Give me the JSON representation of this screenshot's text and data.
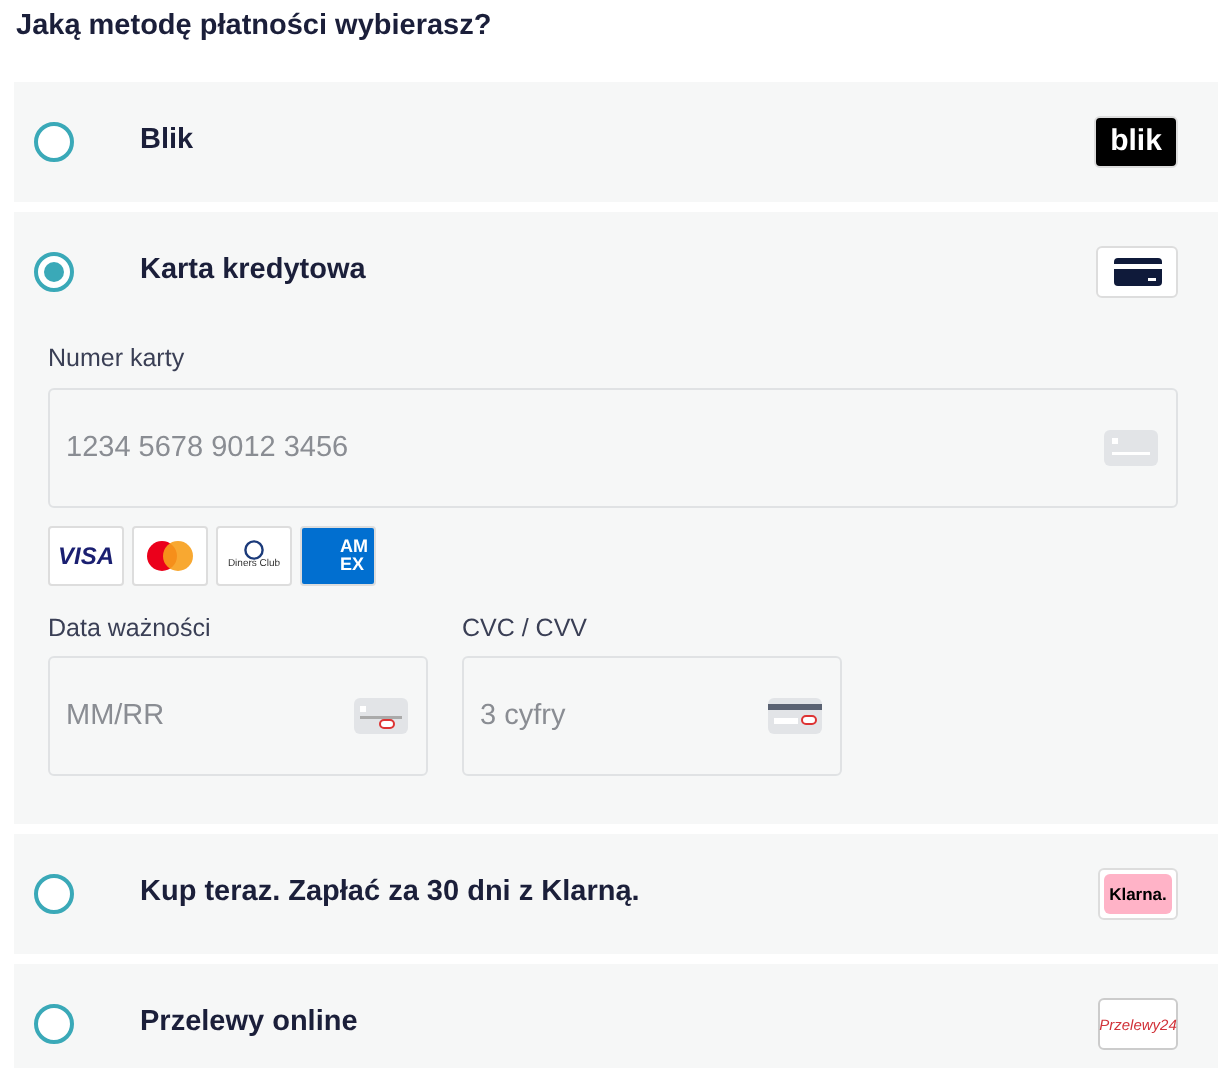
{
  "heading": "Jaką metodę płatności wybierasz?",
  "methods": [
    {
      "label": "Blik",
      "selected": false,
      "logo": {
        "kind": "blik",
        "text": "blik"
      }
    },
    {
      "label": "Karta kredytowa",
      "selected": true,
      "logo": {
        "kind": "card"
      },
      "form": {
        "card_number": {
          "label": "Numer karty",
          "placeholder": "1234 5678 9012 3456"
        },
        "brands": [
          {
            "kind": "visa",
            "text": "VISA"
          },
          {
            "kind": "mastercard"
          },
          {
            "kind": "diners",
            "text": "Diners Club"
          },
          {
            "kind": "amex",
            "text": "AM EX"
          }
        ],
        "expiry": {
          "label": "Data ważności",
          "placeholder": "MM/RR"
        },
        "cvc": {
          "label": "CVC / CVV",
          "placeholder": "3 cyfry"
        }
      }
    },
    {
      "label": "Kup teraz. Zapłać za 30 dni z Klarną.",
      "selected": false,
      "logo": {
        "kind": "klarna",
        "text": "Klarna."
      }
    },
    {
      "label": "Przelewy online",
      "selected": false,
      "logo": {
        "kind": "p24",
        "text": "Przelewy24"
      }
    }
  ]
}
